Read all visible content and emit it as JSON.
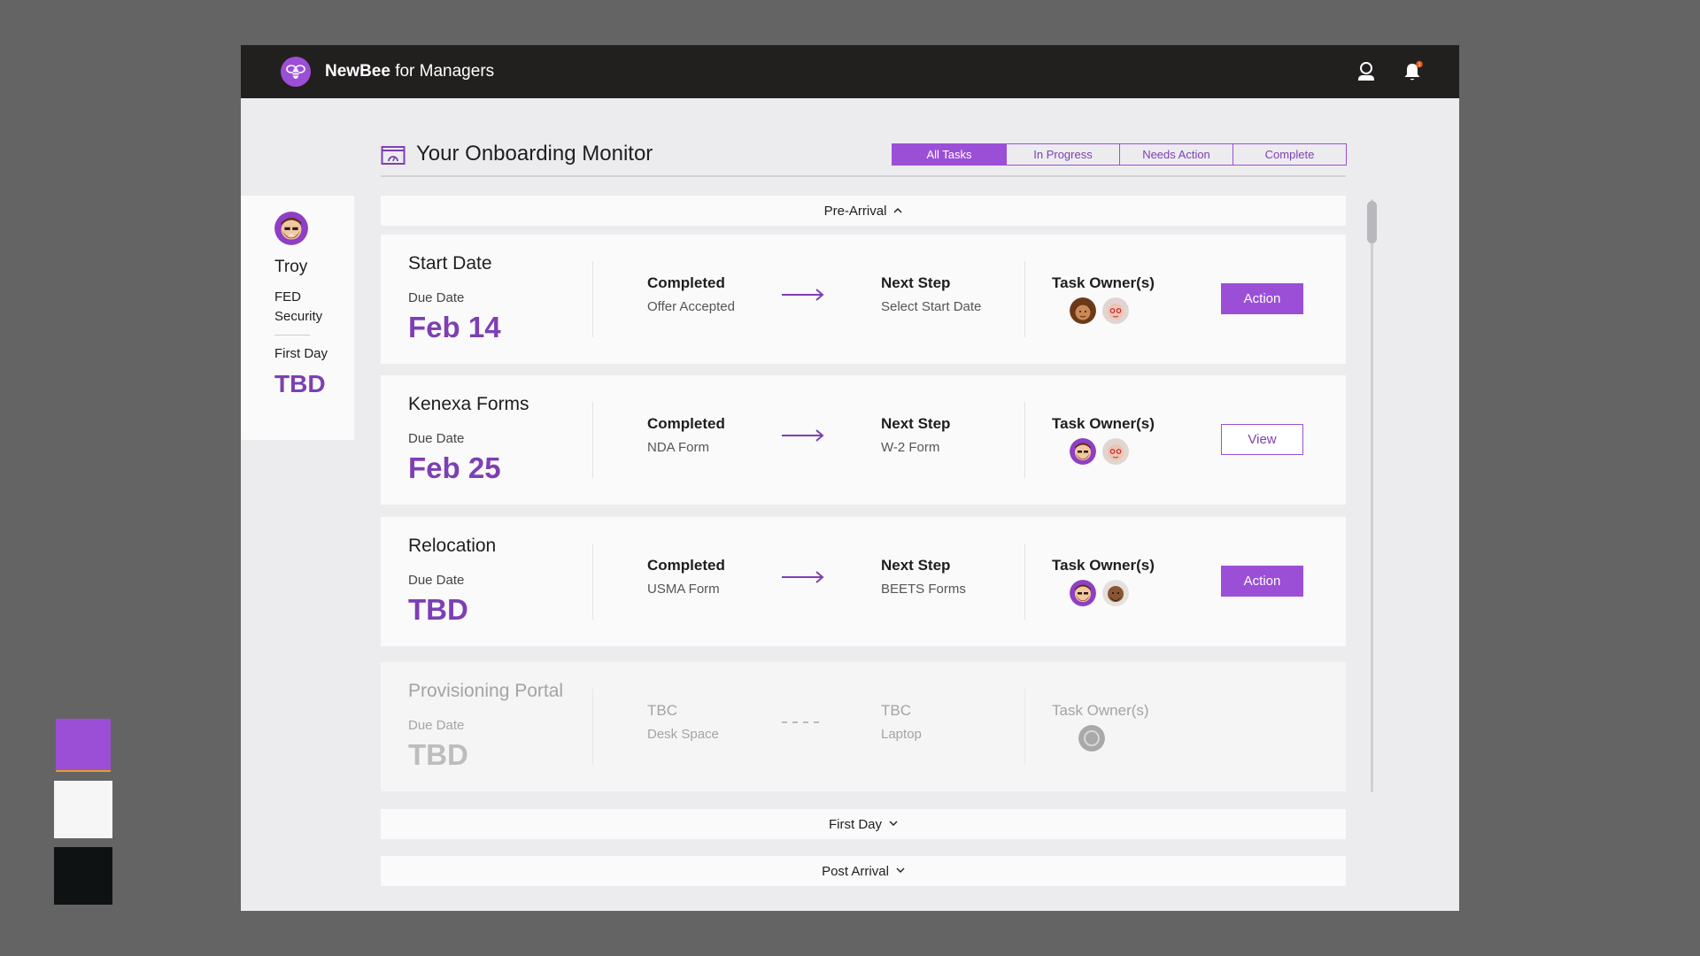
{
  "palette": {
    "colors": [
      "#9b4fd6",
      "#f6f6f6",
      "#0f1212"
    ]
  },
  "header": {
    "brand_name": "NewBee",
    "brand_suffix": "for Managers",
    "logo_icon": "bee-icon",
    "notification_count": "1"
  },
  "employee": {
    "name": "Troy",
    "dept_line1": "FED",
    "dept_line2": "Security",
    "first_day_label": "First Day",
    "first_day_value": "TBD"
  },
  "monitor": {
    "title": "Your Onboarding Monitor",
    "tabs": [
      {
        "label": "All Tasks",
        "active": true
      },
      {
        "label": "In Progress",
        "active": false
      },
      {
        "label": "Needs Action",
        "active": false
      },
      {
        "label": "Complete",
        "active": false
      }
    ]
  },
  "sections": {
    "pre_arrival": "Pre-Arrival",
    "first_day": "First Day",
    "post_arrival": "Post Arrival"
  },
  "labels": {
    "due_date": "Due Date",
    "completed": "Completed",
    "next_step": "Next Step",
    "task_owners": "Task Owner(s)"
  },
  "tasks": [
    {
      "name": "Start Date",
      "due": "Feb 14",
      "completed": "Offer Accepted",
      "next": "Select Start Date",
      "button": "Action"
    },
    {
      "name": "Kenexa Forms",
      "due": "Feb 25",
      "completed": "NDA Form",
      "next": "W-2 Form",
      "button": "View"
    },
    {
      "name": "Relocation",
      "due": "TBD",
      "completed": "USMA Form",
      "next": "BEETS Forms",
      "button": "Action"
    },
    {
      "name": "Provisioning Portal",
      "due": "TBD",
      "completed_header": "TBC",
      "completed": "Desk Space",
      "next_header": "TBC",
      "next": "Laptop"
    }
  ]
}
